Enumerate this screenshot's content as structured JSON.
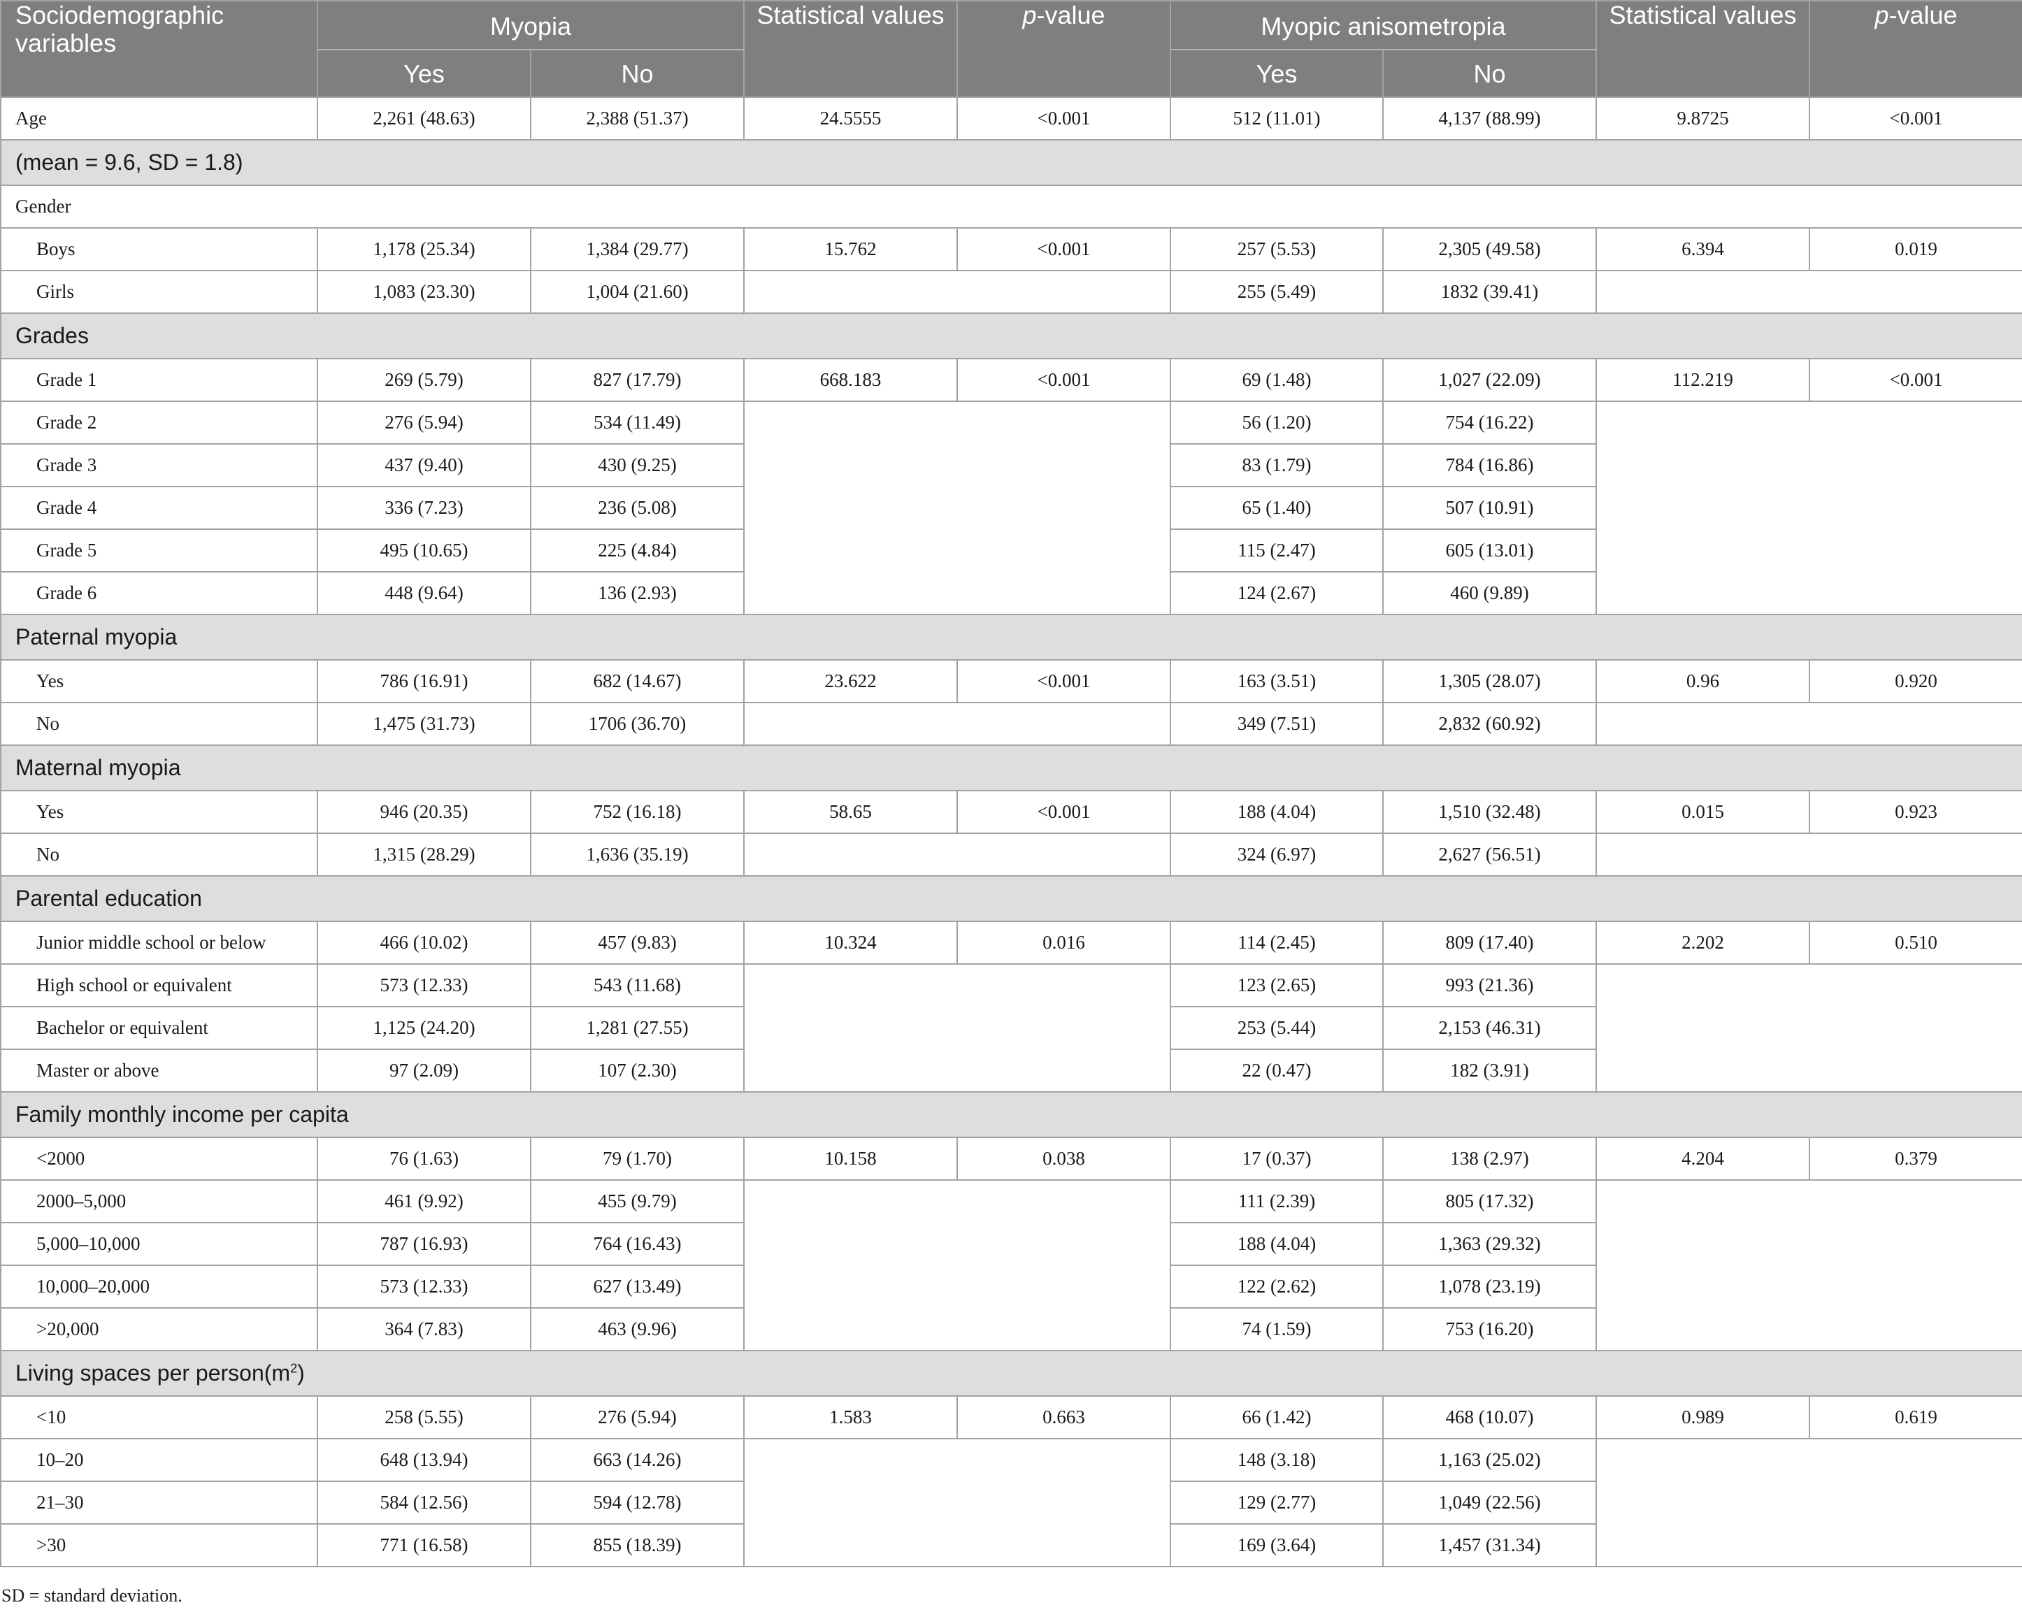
{
  "header": {
    "col_var": "Sociodemographic variables",
    "group_myopia": "Myopia",
    "group_aniso": "Myopic anisometropia",
    "stat": "Statistical values",
    "p_italic": "p",
    "p_rest": "-value",
    "yes": "Yes",
    "no": "No"
  },
  "rows": {
    "age": {
      "label": "Age",
      "cells": [
        "2,261 (48.63)",
        "2,388 (51.37)",
        "24.5555",
        "<0.001",
        "512 (11.01)",
        "4,137 (88.99)",
        "9.8725",
        "<0.001"
      ]
    },
    "age_note": "(mean = 9.6, SD = 1.8)",
    "gender": {
      "label": "Gender",
      "boys": {
        "label": "Boys",
        "cells": [
          "1,178 (25.34)",
          "1,384 (29.77)",
          "15.762",
          "<0.001",
          "257 (5.53)",
          "2,305 (49.58)",
          "6.394",
          "0.019"
        ]
      },
      "girls": {
        "label": "Girls",
        "cells": [
          "1,083 (23.30)",
          "1,004 (21.60)",
          "255 (5.49)",
          "1832 (39.41)"
        ]
      }
    },
    "grades": {
      "label": "Grades",
      "g1": {
        "label": "Grade 1",
        "cells": [
          "269 (5.79)",
          "827 (17.79)",
          "668.183",
          "<0.001",
          "69 (1.48)",
          "1,027 (22.09)",
          "112.219",
          "<0.001"
        ]
      },
      "g2": {
        "label": "Grade 2",
        "cells": [
          "276 (5.94)",
          "534 (11.49)",
          "56 (1.20)",
          "754 (16.22)"
        ]
      },
      "g3": {
        "label": "Grade 3",
        "cells": [
          "437 (9.40)",
          "430 (9.25)",
          "83 (1.79)",
          "784 (16.86)"
        ]
      },
      "g4": {
        "label": "Grade 4",
        "cells": [
          "336 (7.23)",
          "236 (5.08)",
          "65 (1.40)",
          "507 (10.91)"
        ]
      },
      "g5": {
        "label": "Grade 5",
        "cells": [
          "495 (10.65)",
          "225 (4.84)",
          "115 (2.47)",
          "605 (13.01)"
        ]
      },
      "g6": {
        "label": "Grade 6",
        "cells": [
          "448 (9.64)",
          "136 (2.93)",
          "124 (2.67)",
          "460 (9.89)"
        ]
      }
    },
    "paternal": {
      "label": "Paternal myopia",
      "yes": {
        "label": "Yes",
        "cells": [
          "786 (16.91)",
          "682 (14.67)",
          "23.622",
          "<0.001",
          "163 (3.51)",
          "1,305 (28.07)",
          "0.96",
          "0.920"
        ]
      },
      "no": {
        "label": "No",
        "cells": [
          "1,475 (31.73)",
          "1706 (36.70)",
          "349 (7.51)",
          "2,832 (60.92)"
        ]
      }
    },
    "maternal": {
      "label": "Maternal myopia",
      "yes": {
        "label": "Yes",
        "cells": [
          "946 (20.35)",
          "752 (16.18)",
          "58.65",
          "<0.001",
          "188 (4.04)",
          "1,510 (32.48)",
          "0.015",
          "0.923"
        ]
      },
      "no": {
        "label": "No",
        "cells": [
          "1,315 (28.29)",
          "1,636 (35.19)",
          "324 (6.97)",
          "2,627 (56.51)"
        ]
      }
    },
    "education": {
      "label": "Parental education",
      "e1": {
        "label": "Junior middle school or below",
        "cells": [
          "466 (10.02)",
          "457 (9.83)",
          "10.324",
          "0.016",
          "114 (2.45)",
          "809 (17.40)",
          "2.202",
          "0.510"
        ]
      },
      "e2": {
        "label": "High school or equivalent",
        "cells": [
          "573 (12.33)",
          "543 (11.68)",
          "123 (2.65)",
          "993 (21.36)"
        ]
      },
      "e3": {
        "label": "Bachelor or equivalent",
        "cells": [
          "1,125 (24.20)",
          "1,281 (27.55)",
          "253 (5.44)",
          "2,153 (46.31)"
        ]
      },
      "e4": {
        "label": "Master or above",
        "cells": [
          "97 (2.09)",
          "107 (2.30)",
          "22 (0.47)",
          "182 (3.91)"
        ]
      }
    },
    "income": {
      "label": "Family monthly income per capita",
      "i1": {
        "label": "<2000",
        "cells": [
          "76 (1.63)",
          "79 (1.70)",
          "10.158",
          "0.038",
          "17 (0.37)",
          "138 (2.97)",
          "4.204",
          "0.379"
        ]
      },
      "i2": {
        "label": "2000–5,000",
        "cells": [
          "461 (9.92)",
          "455 (9.79)",
          "111 (2.39)",
          "805 (17.32)"
        ]
      },
      "i3": {
        "label": "5,000–10,000",
        "cells": [
          "787 (16.93)",
          "764 (16.43)",
          "188 (4.04)",
          "1,363 (29.32)"
        ]
      },
      "i4": {
        "label": "10,000–20,000",
        "cells": [
          "573 (12.33)",
          "627 (13.49)",
          "122 (2.62)",
          "1,078 (23.19)"
        ]
      },
      "i5": {
        "label": ">20,000",
        "cells": [
          "364 (7.83)",
          "463 (9.96)",
          "74 (1.59)",
          "753 (16.20)"
        ]
      }
    },
    "living": {
      "label": "Living spaces per person(m",
      "label_sup": "2",
      "label_end": ")",
      "l1": {
        "label": "<10",
        "cells": [
          "258 (5.55)",
          "276 (5.94)",
          "1.583",
          "0.663",
          "66 (1.42)",
          "468 (10.07)",
          "0.989",
          "0.619"
        ]
      },
      "l2": {
        "label": "10–20",
        "cells": [
          "648 (13.94)",
          "663 (14.26)",
          "148 (3.18)",
          "1,163 (25.02)"
        ]
      },
      "l3": {
        "label": "21–30",
        "cells": [
          "584 (12.56)",
          "594 (12.78)",
          "129 (2.77)",
          "1,049 (22.56)"
        ]
      },
      "l4": {
        "label": ">30",
        "cells": [
          "771 (16.58)",
          "855 (18.39)",
          "169 (3.64)",
          "1,457 (31.34)"
        ]
      }
    }
  },
  "footnote": "SD = standard deviation."
}
